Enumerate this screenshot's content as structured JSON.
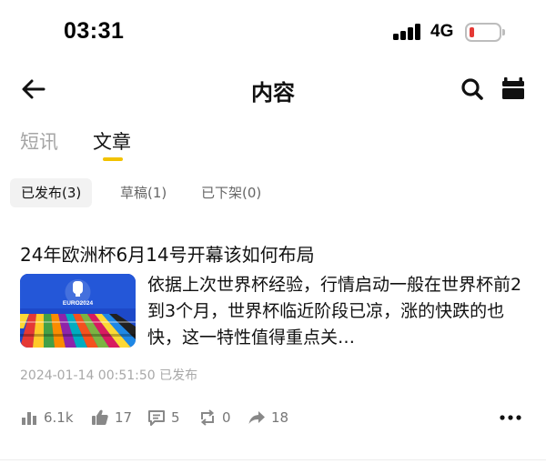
{
  "status_bar": {
    "time": "03:31",
    "network": "4G",
    "battery_color": "#e53935"
  },
  "header": {
    "title": "内容",
    "back_icon": "arrow-left-icon",
    "search_icon": "search-icon",
    "calendar_icon": "calendar-icon"
  },
  "tabs": [
    {
      "label": "短讯",
      "active": false
    },
    {
      "label": "文章",
      "active": true
    }
  ],
  "accent_color": "#f2c200",
  "filters": [
    {
      "label": "已发布(3)",
      "active": true
    },
    {
      "label": "草稿(1)",
      "active": false
    },
    {
      "label": "已下架(0)",
      "active": false
    }
  ],
  "article": {
    "title": "24年欧洲杯6月14号开幕该如何布局",
    "excerpt": "依据上次世界杯经验，行情启动一般在世界杯前2到3个月，世界杯临近阶段已凉，涨的快跌的也快，这一特性值得重点关…",
    "thumbnail_text": "EURO2024",
    "meta": "2024-01-14 00:51:50 已发布",
    "stats": {
      "views": "6.1k",
      "likes": "17",
      "comments": "5",
      "reposts": "0",
      "shares": "18"
    }
  }
}
